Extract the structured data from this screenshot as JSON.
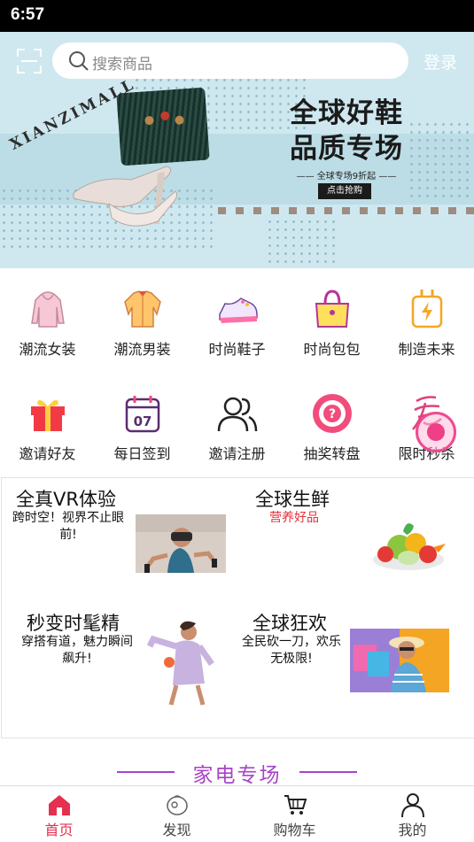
{
  "status_bar": {
    "time": "6:57"
  },
  "header": {
    "search_placeholder": "搜索商品",
    "login_label": "登录"
  },
  "banner": {
    "brand": "XIANZIMALL",
    "title_line1": "全球好鞋",
    "title_line2": "品质专场",
    "subtitle": "—— 全球专场9折起 ——",
    "button_label": "点击抢购"
  },
  "categories": [
    {
      "label": "潮流女装",
      "icon": "hoodie-icon"
    },
    {
      "label": "潮流男装",
      "icon": "shirt-icon"
    },
    {
      "label": "时尚鞋子",
      "icon": "sneaker-icon"
    },
    {
      "label": "时尚包包",
      "icon": "handbag-icon"
    },
    {
      "label": "制造未来",
      "icon": "charger-icon"
    },
    {
      "label": "邀请好友",
      "icon": "gift-icon"
    },
    {
      "label": "每日签到",
      "icon": "calendar-icon"
    },
    {
      "label": "邀请注册",
      "icon": "users-icon"
    },
    {
      "label": "抽奖转盘",
      "icon": "lottery-wheel-icon"
    },
    {
      "label": "限时秒杀",
      "icon": "flash-sale-icon"
    }
  ],
  "promo_cards": [
    {
      "title": "全真VR体验",
      "subtitle": "跨时空！视界不止眼前!"
    },
    {
      "title": "全球生鲜",
      "subtitle": "营养好品"
    },
    {
      "title": "秒变时髦精",
      "subtitle": "穿搭有道，魅力瞬间飙升!"
    },
    {
      "title": "全球狂欢",
      "subtitle": "全民砍一刀，欢乐无极限!"
    }
  ],
  "section": {
    "title": "家电专场"
  },
  "tabs": [
    {
      "label": "首页",
      "icon": "home-icon",
      "active": true
    },
    {
      "label": "发现",
      "icon": "discover-icon",
      "active": false
    },
    {
      "label": "购物车",
      "icon": "cart-icon",
      "active": false
    },
    {
      "label": "我的",
      "icon": "profile-icon",
      "active": false
    }
  ],
  "colors": {
    "accent": "#e5304f",
    "section_purple": "#a844c8",
    "banner_bg": "#cfe8ef",
    "fresh_red": "#e5303b"
  }
}
